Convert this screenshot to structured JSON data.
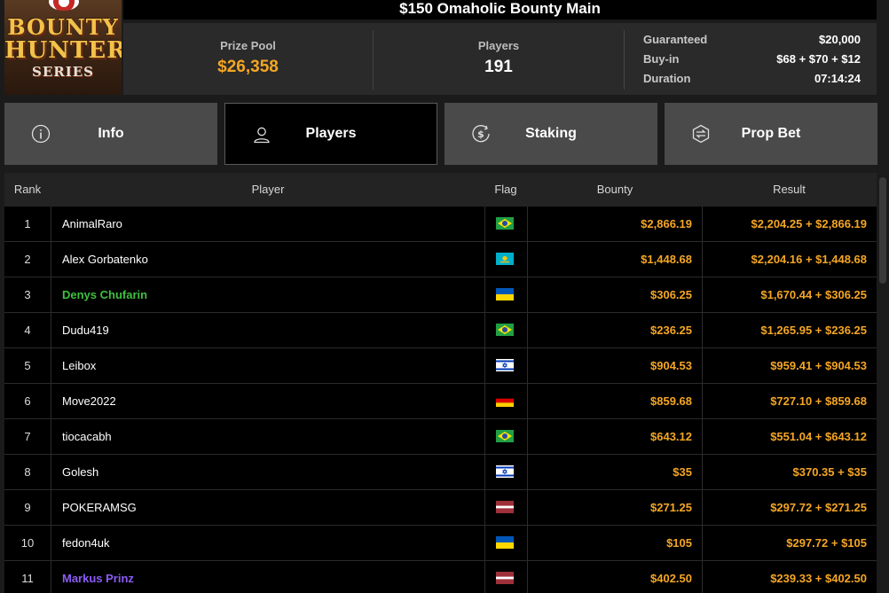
{
  "logo": {
    "line1": "BOUNTY",
    "line2": "HUNTERS",
    "line3": "SERIES"
  },
  "title": "$150 Omaholic Bounty Main",
  "stats": {
    "prize_pool_label": "Prize Pool",
    "prize_pool_value": "$26,358",
    "players_label": "Players",
    "players_value": "191",
    "guaranteed_label": "Guaranteed",
    "guaranteed_value": "$20,000",
    "buyin_label": "Buy-in",
    "buyin_value": "$68 + $70 + $12",
    "duration_label": "Duration",
    "duration_value": "07:14:24"
  },
  "tabs": [
    {
      "label": "Info",
      "icon": "info-icon"
    },
    {
      "label": "Players",
      "icon": "user-icon",
      "active": true
    },
    {
      "label": "Staking",
      "icon": "dollar-coin-icon"
    },
    {
      "label": "Prop Bet",
      "icon": "prop-bet-icon"
    }
  ],
  "table": {
    "headers": {
      "rank": "Rank",
      "player": "Player",
      "flag": "Flag",
      "bounty": "Bounty",
      "result": "Result"
    },
    "rows": [
      {
        "rank": "1",
        "player": "AnimalRaro",
        "flag": "brazil",
        "bounty": "$2,866.19",
        "result": "$2,204.25 + $2,866.19",
        "color": ""
      },
      {
        "rank": "2",
        "player": "Alex Gorbatenko",
        "flag": "kazakhstan",
        "bounty": "$1,448.68",
        "result": "$2,204.16 + $1,448.68",
        "color": ""
      },
      {
        "rank": "3",
        "player": "Denys Chufarin",
        "flag": "ukraine",
        "bounty": "$306.25",
        "result": "$1,670.44 + $306.25",
        "color": "green"
      },
      {
        "rank": "4",
        "player": "Dudu419",
        "flag": "brazil",
        "bounty": "$236.25",
        "result": "$1,265.95 + $236.25",
        "color": ""
      },
      {
        "rank": "5",
        "player": "Leibox",
        "flag": "israel",
        "bounty": "$904.53",
        "result": "$959.41 + $904.53",
        "color": ""
      },
      {
        "rank": "6",
        "player": "Move2022",
        "flag": "germany",
        "bounty": "$859.68",
        "result": "$727.10 + $859.68",
        "color": ""
      },
      {
        "rank": "7",
        "player": "tiocacabh",
        "flag": "brazil",
        "bounty": "$643.12",
        "result": "$551.04 + $643.12",
        "color": ""
      },
      {
        "rank": "8",
        "player": "Golesh",
        "flag": "israel",
        "bounty": "$35",
        "result": "$370.35 + $35",
        "color": ""
      },
      {
        "rank": "9",
        "player": "POKERAMSG",
        "flag": "latvia",
        "bounty": "$271.25",
        "result": "$297.72 + $271.25",
        "color": ""
      },
      {
        "rank": "10",
        "player": "fedon4uk",
        "flag": "ukraine",
        "bounty": "$105",
        "result": "$297.72 + $105",
        "color": ""
      },
      {
        "rank": "11",
        "player": "Markus Prinz",
        "flag": "latvia",
        "bounty": "$402.50",
        "result": "$239.33 + $402.50",
        "color": "purple"
      }
    ]
  },
  "colors": {
    "accent": "#f5a623",
    "green_name": "#3fbf3f",
    "purple_name": "#8b5cf6",
    "background": "#1b1b1b"
  }
}
